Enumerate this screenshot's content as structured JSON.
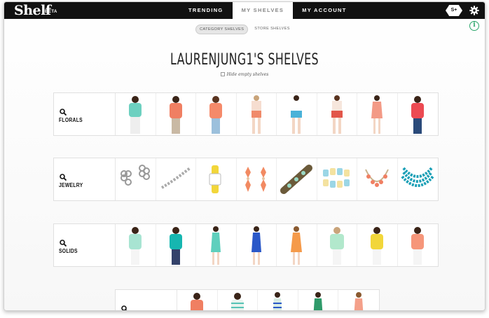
{
  "header": {
    "logo": "Shelf",
    "beta": "BETA",
    "nav": [
      {
        "label": "TRENDING",
        "active": false
      },
      {
        "label": "MY SHELVES",
        "active": true
      },
      {
        "label": "MY ACCOUNT",
        "active": false
      }
    ],
    "badge": "S+"
  },
  "toggle": {
    "category": "CATEGORY SHELVES",
    "store": "STORE SHELVES"
  },
  "info": "i",
  "page_title": "LAURENJUNG1'S SHELVES",
  "hide_empty_label": "Hide empty shelves",
  "shelves": [
    {
      "name": "FLORALS",
      "items": [
        "floral-top-teal",
        "floral-top-coral",
        "floral-top-orange",
        "floral-shorts-outfit",
        "floral-shorts-blue",
        "floral-shorts-red",
        "floral-dress-pink",
        "floral-top-red"
      ]
    },
    {
      "name": "JEWELRY",
      "items": [
        "silver-earrings",
        "silver-bracelet",
        "yellow-watch",
        "coral-earrings",
        "statement-bracelet",
        "stone-bracelet",
        "coral-necklace",
        "turquoise-necklace"
      ]
    },
    {
      "name": "SOLIDS",
      "items": [
        "mint-top",
        "teal-top",
        "mint-dress",
        "blue-dress",
        "orange-dress",
        "mint-blouse",
        "yellow-top",
        "coral-top"
      ]
    },
    {
      "name": "",
      "items": [
        "coral-top-2",
        "striped-top",
        "striped-dress",
        "green-dress",
        "coral-dress"
      ]
    }
  ],
  "colors": {
    "topbar": "#111111",
    "accent_green": "#2aa56a",
    "coral": "#f07f62",
    "teal": "#56c3b6",
    "turquoise": "#1a9fb6",
    "mint": "#a8e4d2",
    "blue": "#2a58c8",
    "yellow": "#f2d63a",
    "orange": "#f59a4a"
  }
}
